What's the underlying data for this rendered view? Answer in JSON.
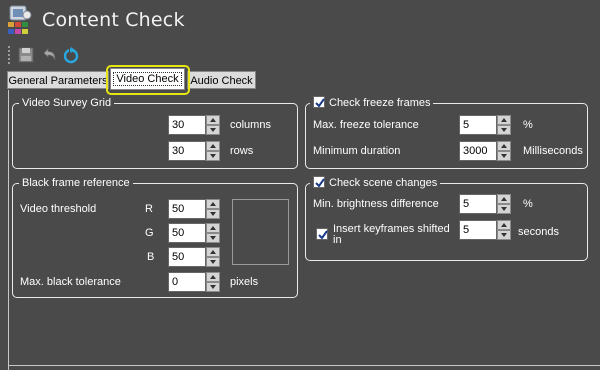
{
  "app": {
    "title": "Content Check"
  },
  "toolbar": {
    "buttons": [
      "save-icon",
      "undo-icon",
      "refresh-icon"
    ]
  },
  "tabs": [
    {
      "label": "General Parameters",
      "active": false
    },
    {
      "label": "Video Check",
      "active": true
    },
    {
      "label": "Audio Check",
      "active": false
    }
  ],
  "survey_grid": {
    "title": "Video Survey Grid",
    "columns": {
      "value": "30",
      "unit": "columns"
    },
    "rows": {
      "value": "30",
      "unit": "rows"
    }
  },
  "black_frame": {
    "title": "Black frame reference",
    "threshold_label": "Video threshold",
    "r": {
      "label": "R",
      "value": "50"
    },
    "g": {
      "label": "G",
      "value": "50"
    },
    "b": {
      "label": "B",
      "value": "50"
    },
    "tolerance": {
      "label": "Max. black tolerance",
      "value": "0",
      "unit": "pixels"
    }
  },
  "freeze": {
    "checked": true,
    "title": "Check freeze frames",
    "tolerance": {
      "label": "Max. freeze tolerance",
      "value": "5",
      "unit": "%"
    },
    "duration": {
      "label": "Minimum duration",
      "value": "3000",
      "unit": "Milliseconds"
    }
  },
  "scene": {
    "checked": true,
    "title": "Check scene changes",
    "brightness": {
      "label": "Min. brightness difference",
      "value": "5",
      "unit": "%"
    },
    "keyframes": {
      "checked": true,
      "label_line1": "Insert keyframes shifted",
      "label_line2": "in",
      "value": "5",
      "unit": "seconds"
    }
  },
  "colors": {
    "background": "#4a4a4a",
    "highlight": "#e6e617",
    "border": "#eaeaea"
  }
}
